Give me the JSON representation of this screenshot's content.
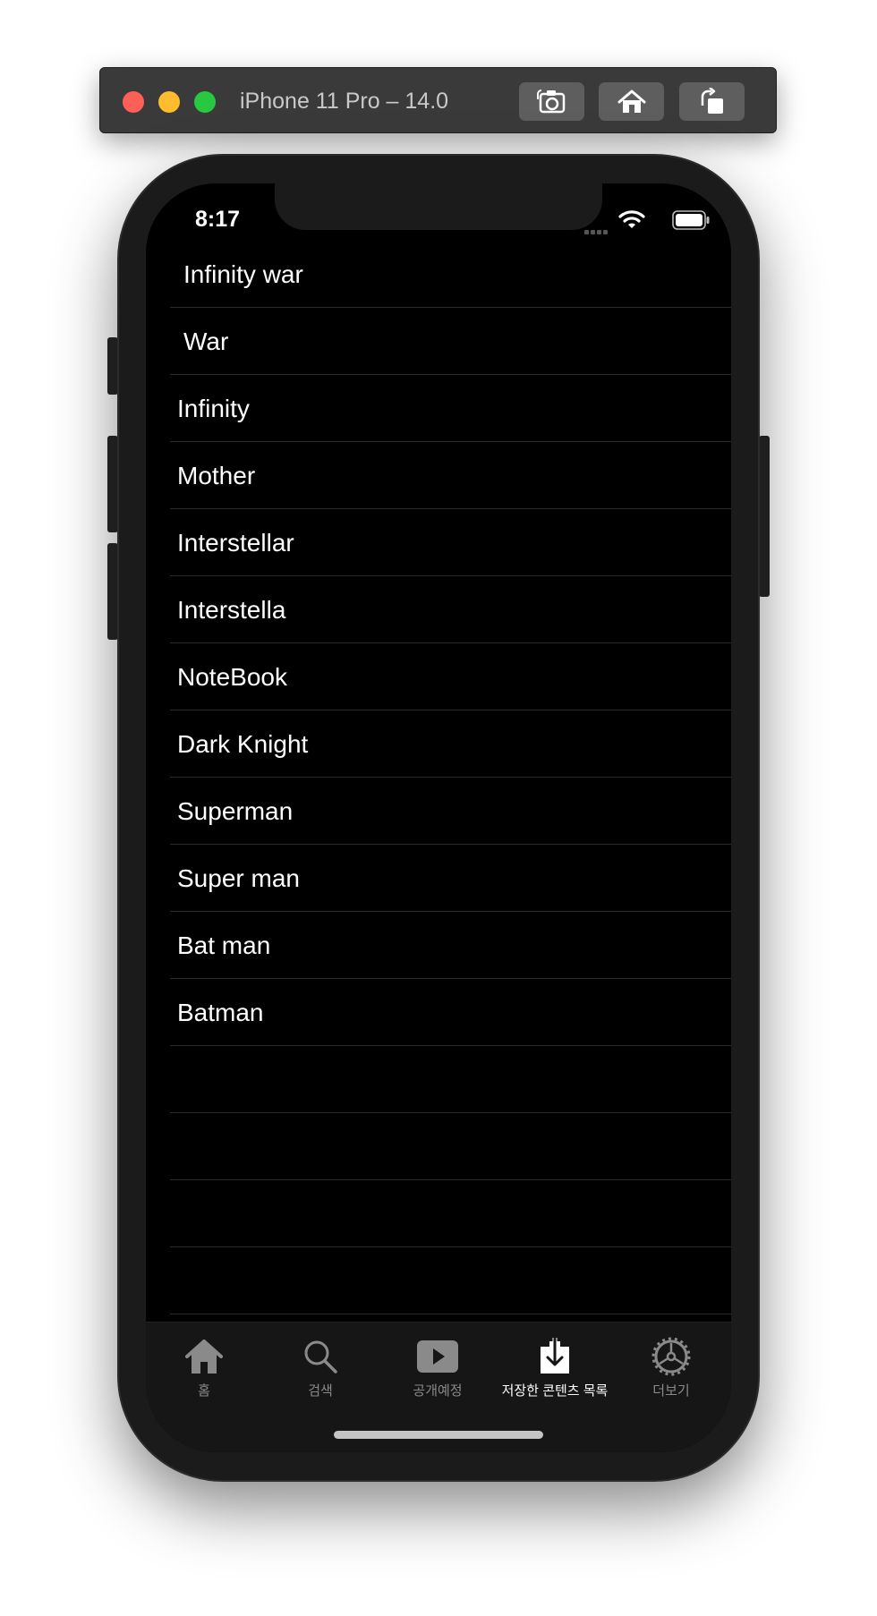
{
  "simulator": {
    "title": "iPhone 11 Pro – 14.0",
    "buttons": [
      "screenshot-icon",
      "home-icon",
      "rotate-icon"
    ]
  },
  "status_bar": {
    "time": "8:17"
  },
  "movies": [
    {
      "title": "Infinity war"
    },
    {
      "title": "War"
    },
    {
      "title": "Infinity"
    },
    {
      "title": "Mother"
    },
    {
      "title": "Interstellar"
    },
    {
      "title": "Interstella"
    },
    {
      "title": "NoteBook"
    },
    {
      "title": "Dark Knight"
    },
    {
      "title": "Superman"
    },
    {
      "title": "Super man"
    },
    {
      "title": "Bat man"
    },
    {
      "title": "Batman"
    },
    {
      "title": ""
    },
    {
      "title": ""
    },
    {
      "title": ""
    },
    {
      "title": ""
    }
  ],
  "tabbar": {
    "tabs": [
      {
        "label": "홈",
        "icon": "home-icon",
        "active": false
      },
      {
        "label": "검색",
        "icon": "search-icon",
        "active": false
      },
      {
        "label": "공개예정",
        "icon": "play-icon",
        "active": false
      },
      {
        "label": "저장한 콘텐츠 목록",
        "icon": "download-icon",
        "active": true
      },
      {
        "label": "더보기",
        "icon": "gear-icon",
        "active": false
      }
    ]
  },
  "colors": {
    "background": "#000000",
    "tab_active": "#ffffff",
    "tab_inactive": "#8a8a8a"
  }
}
